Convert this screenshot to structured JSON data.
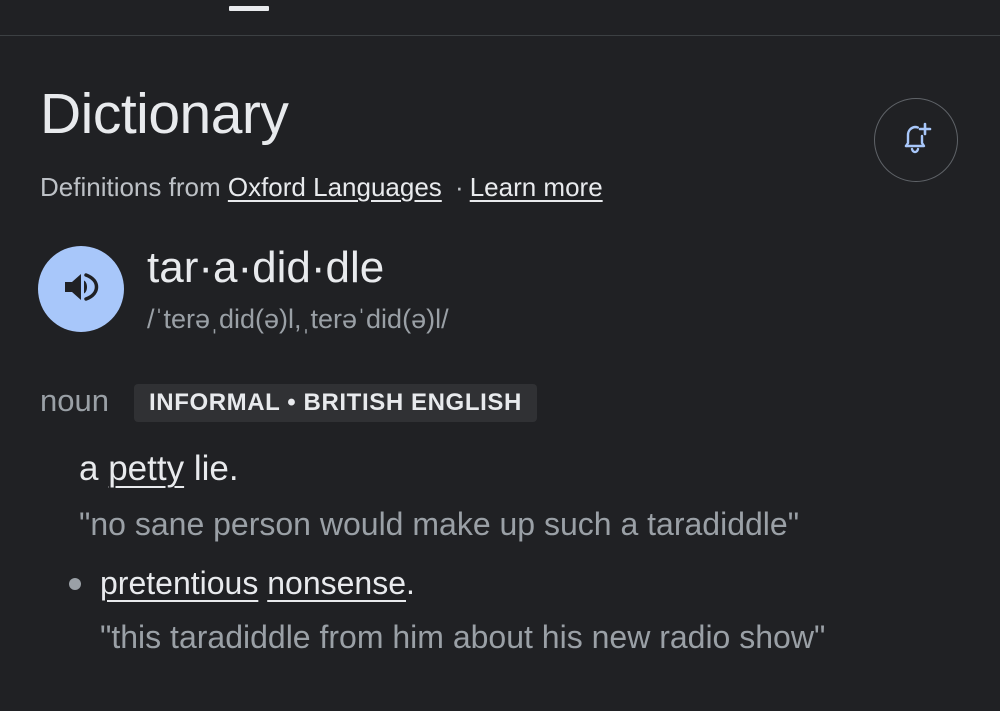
{
  "header": {
    "title": "Dictionary",
    "source_prefix": "Definitions from",
    "source_link": "Oxford Languages",
    "separator": "·",
    "learn_more": "Learn more",
    "alert_icon": "bell-plus-icon"
  },
  "entry": {
    "headword": "tar·a·did·dle",
    "phonetic": "/ˈterəˌdid(ə)l,ˌterəˈdid(ə)l/",
    "speaker_icon": "speaker-icon",
    "speaker_color": "#a8c7fa",
    "part_of_speech": "noun",
    "usage_label": "INFORMAL • BRITISH ENGLISH",
    "senses": [
      {
        "prefix": "a ",
        "link": "petty",
        "suffix": " lie.",
        "example": "\"no sane person would make up such a taradiddle\""
      },
      {
        "link1": "pretentious",
        "middle": " ",
        "link2": "nonsense",
        "suffix": ".",
        "example": "\"this taradiddle from him about his new radio show\""
      }
    ]
  }
}
